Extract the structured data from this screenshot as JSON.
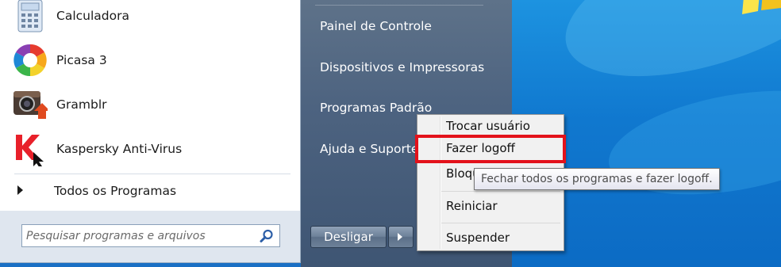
{
  "programs": [
    {
      "label": "Calculadora",
      "icon": "calculator-icon"
    },
    {
      "label": "Picasa 3",
      "icon": "picasa-icon"
    },
    {
      "label": "Gramblr",
      "icon": "gramblr-icon"
    },
    {
      "label": "Kaspersky Anti-Virus",
      "icon": "kaspersky-icon"
    }
  ],
  "all_programs_label": "Todos os Programas",
  "search": {
    "placeholder": "Pesquisar programas e arquivos",
    "icon": "search-icon"
  },
  "right_links": [
    "Painel de Controle",
    "Dispositivos e Impressoras",
    "Programas Padrão",
    "Ajuda e Suporte"
  ],
  "shutdown": {
    "label": "Desligar",
    "arrow_icon": "arrow-right-icon"
  },
  "power_menu": {
    "items": [
      "Trocar usuário",
      "Fazer logoff",
      "Bloquear",
      "Reiniciar",
      "Suspender"
    ],
    "highlighted_item": "Fazer logoff",
    "highlight_color": "#e3121b"
  },
  "tooltip": "Fechar todos os programas e fazer logoff."
}
